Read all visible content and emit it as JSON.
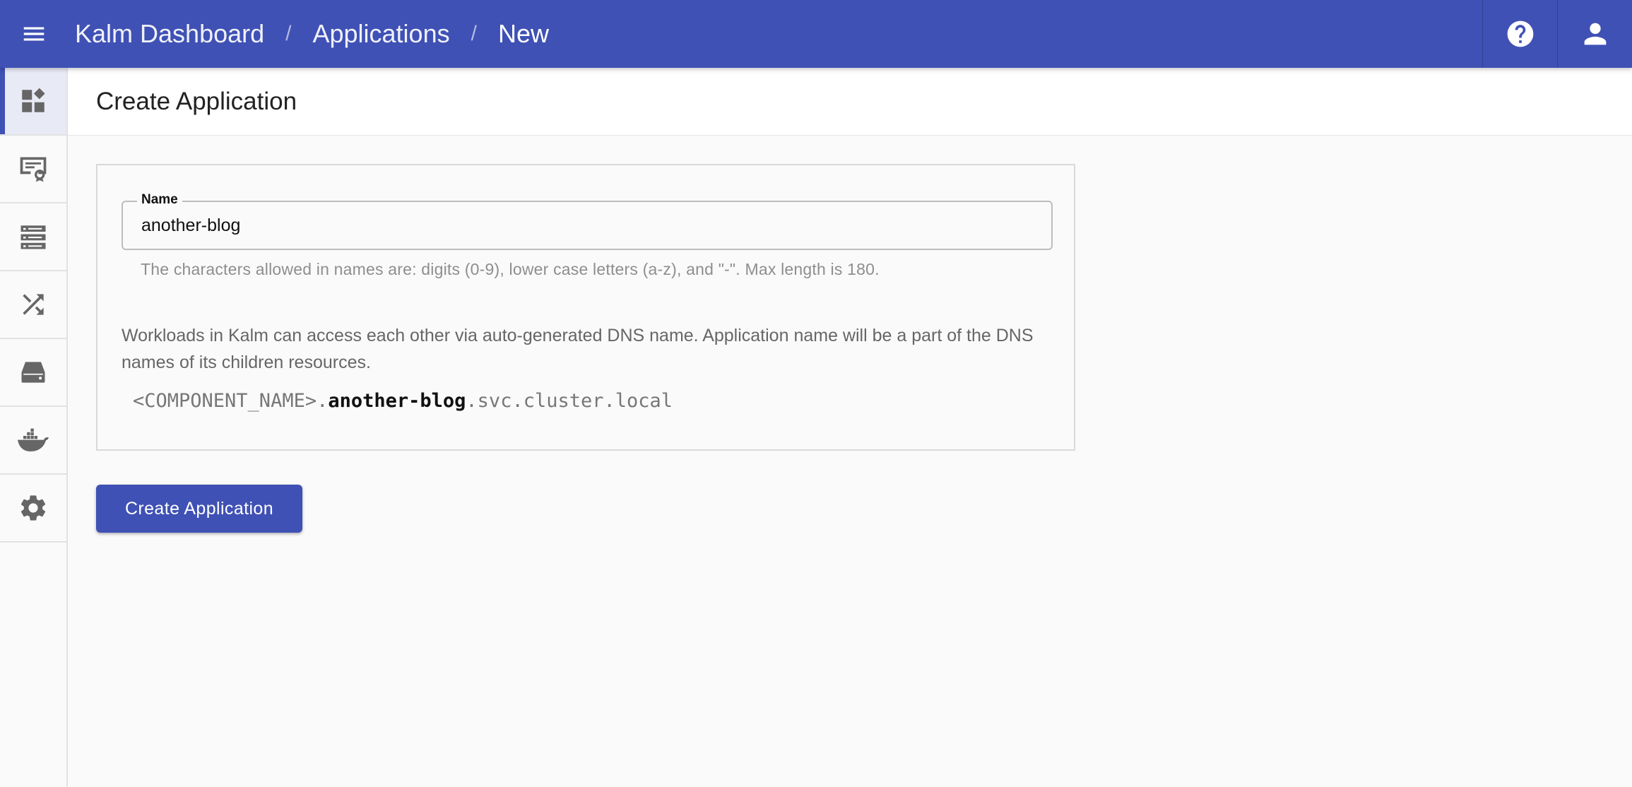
{
  "appbar": {
    "menu_icon": "menu-icon",
    "breadcrumb": [
      {
        "label": "Kalm Dashboard"
      },
      {
        "label": "Applications"
      },
      {
        "label": "New"
      }
    ],
    "separator": "/",
    "help_icon": "help-circle-icon",
    "account_icon": "account-icon",
    "color": "#3f51b5"
  },
  "sidebar": {
    "items": [
      {
        "icon": "dashboard-icon",
        "active": true
      },
      {
        "icon": "certificate-icon",
        "active": false
      },
      {
        "icon": "nodes-icon",
        "active": false
      },
      {
        "icon": "routes-shuffle-icon",
        "active": false
      },
      {
        "icon": "disk-storage-icon",
        "active": false
      },
      {
        "icon": "docker-registry-icon",
        "active": false
      },
      {
        "icon": "settings-gear-icon",
        "active": false
      }
    ]
  },
  "page": {
    "title": "Create Application"
  },
  "form": {
    "name_label": "Name",
    "name_value": "another-blog",
    "helper_text": "The characters allowed in names are: digits (0-9), lower case letters (a-z), and \"-\". Max length is 180.",
    "description": "Workloads in Kalm can access each other via auto-generated DNS name. Application name will be a part of the DNS names of its children resources.",
    "dns_prefix": "<COMPONENT_NAME>.",
    "dns_name": "another-blog",
    "dns_suffix": ".svc.cluster.local",
    "submit_label": "Create Application"
  }
}
